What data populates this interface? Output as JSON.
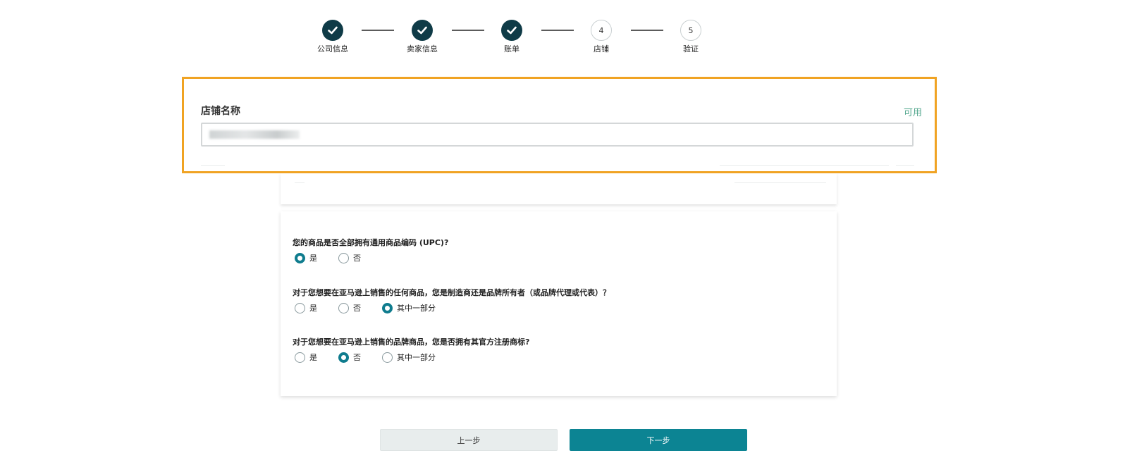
{
  "stepper": {
    "steps": [
      {
        "label": "公司信息",
        "state": "done"
      },
      {
        "label": "卖家信息",
        "state": "done"
      },
      {
        "label": "账单",
        "state": "done"
      },
      {
        "label": "店铺",
        "number": "4",
        "state": "current"
      },
      {
        "label": "验证",
        "number": "5",
        "state": "todo"
      }
    ]
  },
  "store": {
    "title": "店铺名称",
    "status": "可用",
    "highlight_color": "#f0a323",
    "status_color": "#4fa58b"
  },
  "questions": [
    {
      "text": "您的商品是否全部拥有通用商品编码 (UPC)?",
      "options": [
        "是",
        "否"
      ],
      "selected": "是"
    },
    {
      "text": "对于您想要在亚马逊上销售的任何商品，您是制造商还是品牌所有者（或品牌代理或代表）？",
      "options": [
        "是",
        "否",
        "其中一部分"
      ],
      "selected": "其中一部分"
    },
    {
      "text": "对于您想要在亚马逊上销售的品牌商品，您是否拥有其官方注册商标?",
      "options": [
        "是",
        "否",
        "其中一部分"
      ],
      "selected": "否"
    }
  ],
  "buttons": {
    "prev": "上一步",
    "next": "下一步",
    "next_color": "#0c8493"
  }
}
